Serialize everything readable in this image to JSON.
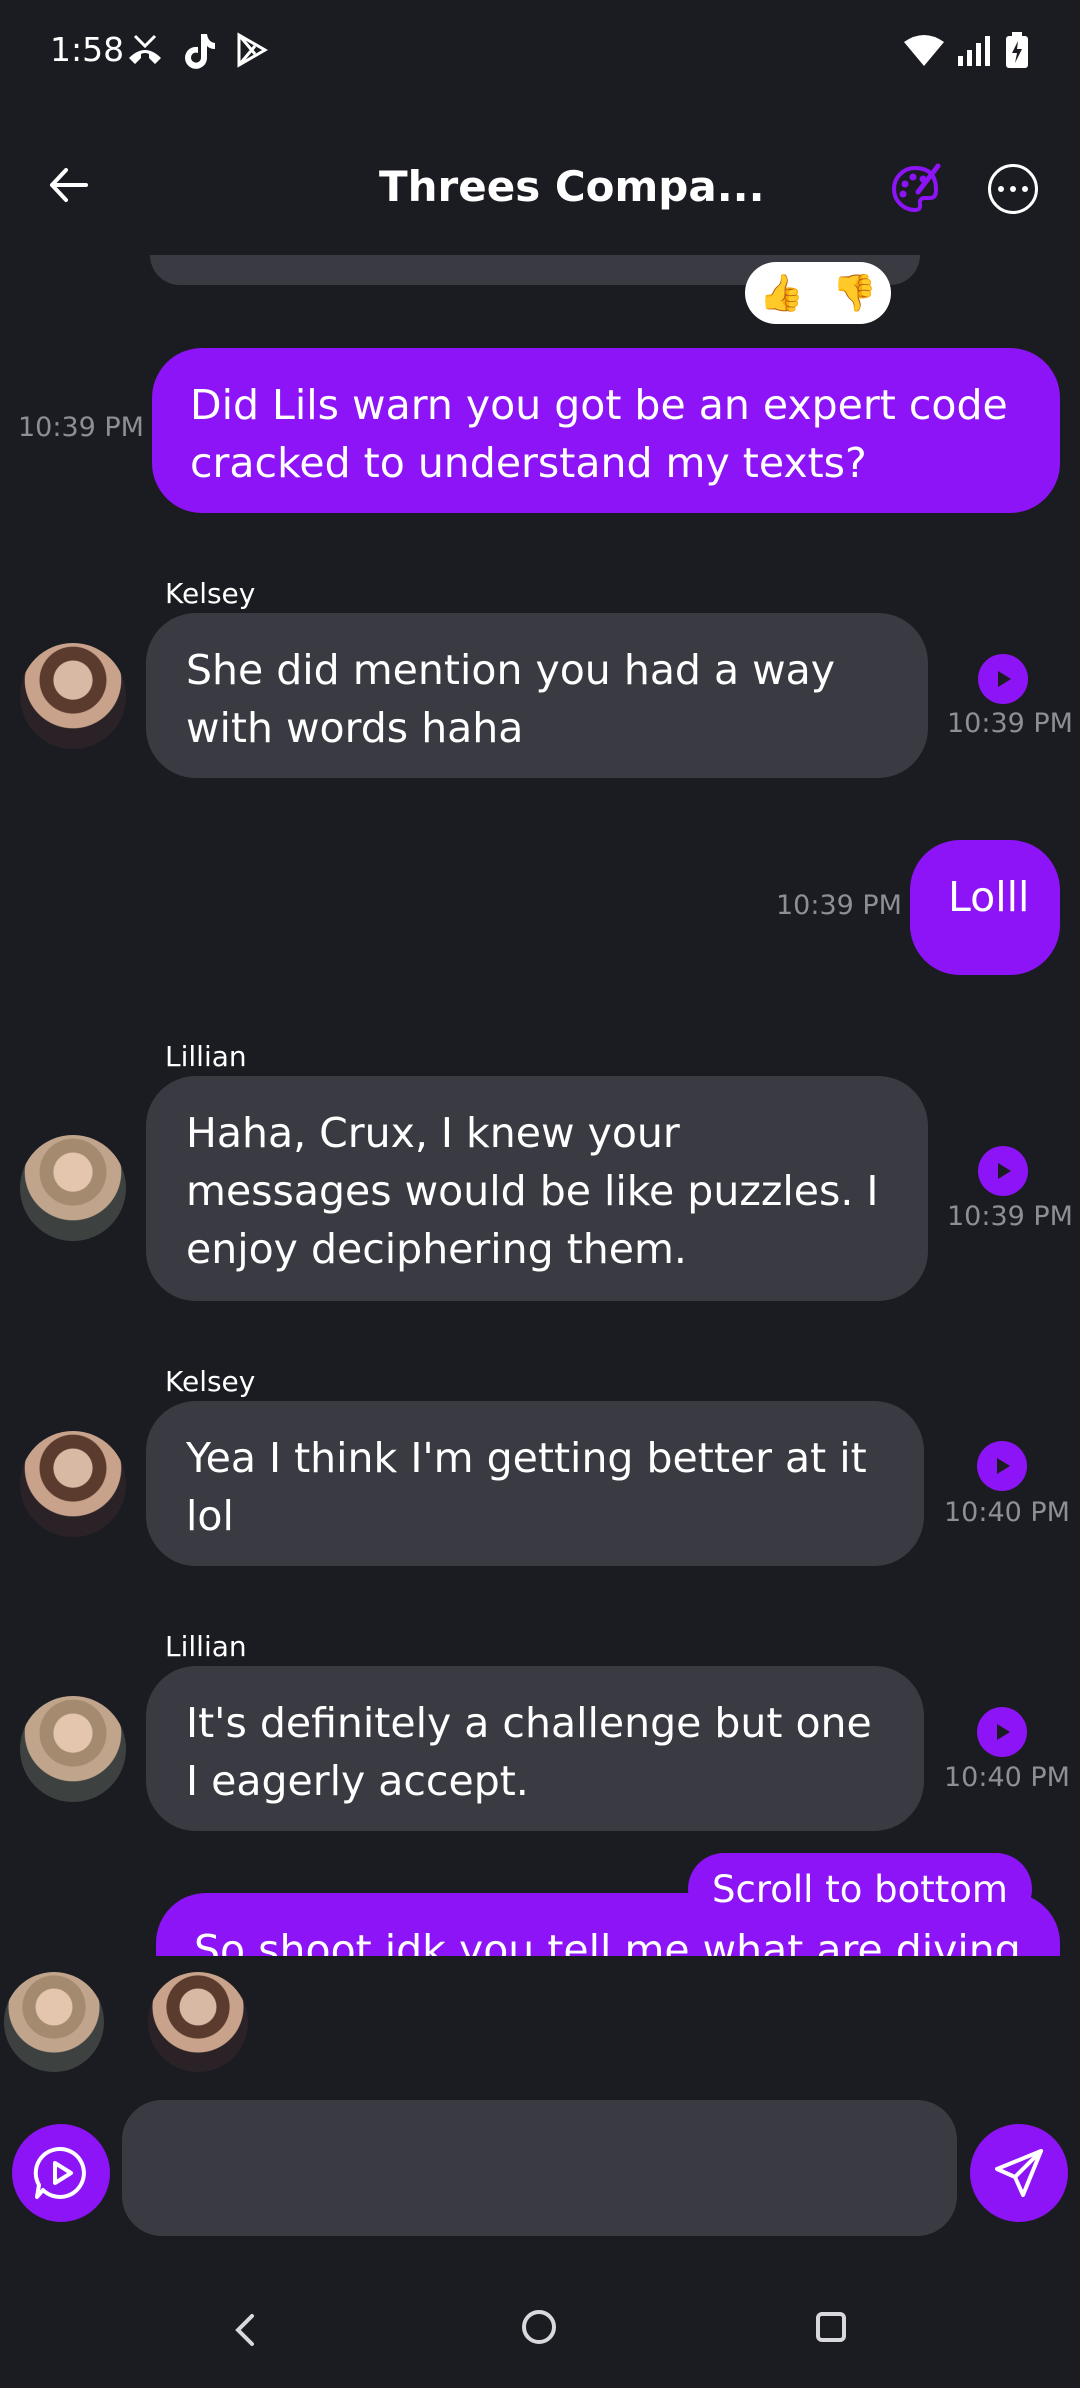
{
  "status_bar": {
    "time": "1:58"
  },
  "header": {
    "title": "Threes Compa..."
  },
  "messages": [
    {
      "side": "out",
      "text": "Did Lils warn you got be an expert code cracked to understand my texts?",
      "time": "10:39 PM"
    },
    {
      "side": "in",
      "sender": "Kelsey",
      "text": "She did mention you had a way with words haha",
      "time": "10:39 PM"
    },
    {
      "side": "out",
      "text": "Lolll",
      "time": "10:39 PM"
    },
    {
      "side": "in",
      "sender": "Lillian",
      "text": "Haha, Crux, I knew your messages would be like puzzles. I enjoy deciphering them.",
      "time": "10:39 PM"
    },
    {
      "side": "in",
      "sender": "Kelsey",
      "text": "Yea I think I'm getting better at it lol",
      "time": "10:40 PM"
    },
    {
      "side": "in",
      "sender": "Lillian",
      "text": "It's definitely a challenge but one I eagerly accept.",
      "time": "10:40 PM"
    },
    {
      "side": "out",
      "text": "So shoot idk you tell me what are diving",
      "time": ""
    }
  ],
  "reactions": [
    "👍",
    "👎"
  ],
  "scroll_button": "Scroll to bottom",
  "composer": {
    "placeholder": ""
  },
  "colors": {
    "accent": "#8d14f6",
    "background": "#1b1c21",
    "incoming_bubble": "#3a3b42"
  }
}
